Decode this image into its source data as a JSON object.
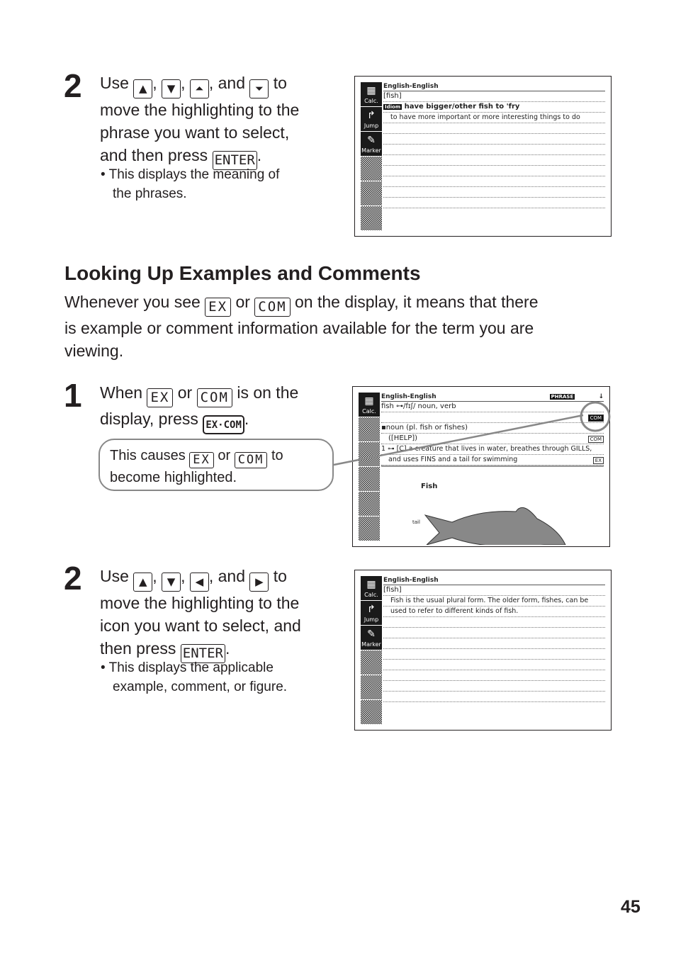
{
  "step2_top": {
    "number": "2",
    "use": "Use",
    "keys": [
      "▲",
      "▼",
      "⏶",
      "⏷"
    ],
    "and": "and",
    "to": "to",
    "text_lines": [
      "move the highlighting to the",
      "phrase you want to select,",
      "and then press"
    ],
    "enter_key": "ENTER",
    "bullet": "• This displays the meaning of",
    "bullet2": "the phrases."
  },
  "screen1": {
    "sidebar": [
      "Calc.",
      "Jump",
      "Marker"
    ],
    "header": "English-English",
    "lines": [
      "[fish]",
      "have bigger/other fish to 'fry",
      "to have more important or more interesting things to do"
    ],
    "idiom_badge": "Idiom"
  },
  "section": {
    "title": "Looking Up Examples and Comments",
    "p1_a": "Whenever you see",
    "ex_key": "EX",
    "or": "or",
    "com_key": "COM",
    "p1_b": "on the display, it means that there",
    "p2": "is example or comment information available for the term you are",
    "p3": "viewing."
  },
  "step1": {
    "number": "1",
    "when": "When",
    "is_on": "is on the",
    "display_press": "display, press",
    "excom_key": "EX·COM",
    "bubble_a": "This causes",
    "bubble_to": "to",
    "bubble_b": "become highlighted."
  },
  "screen2": {
    "header": "English-English",
    "phrase_badge": "PHRASE",
    "arrow": "↓",
    "lines": [
      "fish ⊶/fɪʃ/ noun, verb",
      "",
      "▪noun (pl. fish or fishes)",
      "([HELP])",
      "1 ⊶ [C] a creature that lives in water, breathes through GILLS,",
      "and uses FINS and a tail for swimming"
    ],
    "com": "COM",
    "ex": "EX",
    "fig_label": "Fish",
    "tail_label": "tail"
  },
  "step2_bottom": {
    "number": "2",
    "use": "Use",
    "keys": [
      "▲",
      "▼",
      "◀",
      "▶"
    ],
    "and": "and",
    "to": "to",
    "text_lines": [
      "move the highlighting to the",
      "icon you want to select, and",
      "then press"
    ],
    "enter_key": "ENTER",
    "bullet": "• This displays the applicable",
    "bullet2": "example, comment, or figure."
  },
  "screen3": {
    "header": "English-English",
    "lines": [
      "[fish]",
      "Fish is the usual plural form. The older form, fishes, can be",
      "used to refer to different kinds of fish."
    ]
  },
  "page_number": "45"
}
